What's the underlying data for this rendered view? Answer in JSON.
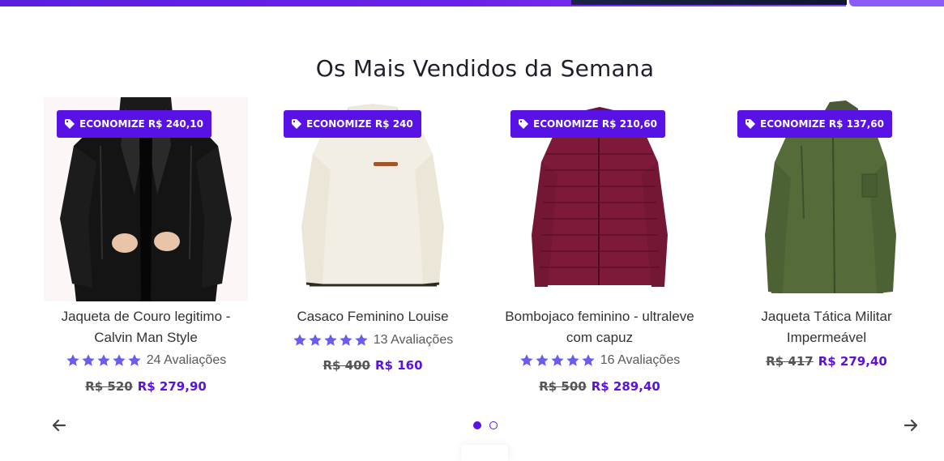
{
  "section_title": "Os Mais Vendidos da Semana",
  "products": [
    {
      "badge": "ECONOMIZE R$ 240,10",
      "name_lines": [
        "Jaqueta de Couro legitimo -",
        "Calvin Man Style"
      ],
      "rating_text": "24 Avaliações",
      "old_price": "R$ 520",
      "new_price": "R$ 279,90",
      "image": "black-leather-jacket"
    },
    {
      "badge": "ECONOMIZE R$ 240",
      "name_lines": [
        "Casaco Feminino Louise"
      ],
      "rating_text": "13 Avaliações",
      "old_price": "R$ 400",
      "new_price": "R$ 160",
      "image": "cream-sherpa-pullover"
    },
    {
      "badge": "ECONOMIZE R$ 210,60",
      "name_lines": [
        "Bombojaco feminino - ultraleve",
        "com capuz"
      ],
      "rating_text": "16 Avaliações",
      "old_price": "R$ 500",
      "new_price": "R$ 289,40",
      "image": "burgundy-puffer-jacket"
    },
    {
      "badge": "ECONOMIZE R$ 137,60",
      "name_lines": [
        "Jaqueta Tática Militar",
        "Impermeável"
      ],
      "rating_text": "",
      "old_price": "R$ 417",
      "new_price": "R$ 279,40",
      "image": "green-tactical-jacket"
    }
  ],
  "rating_stars": 5,
  "colors": {
    "accent": "#5812e6",
    "star": "#6a5cf0",
    "price": "#5a12e0"
  },
  "carousel": {
    "pages": 2,
    "current": 1
  },
  "icons": [
    "tag-icon",
    "star-icon",
    "arrow-left-icon",
    "arrow-right-icon"
  ]
}
